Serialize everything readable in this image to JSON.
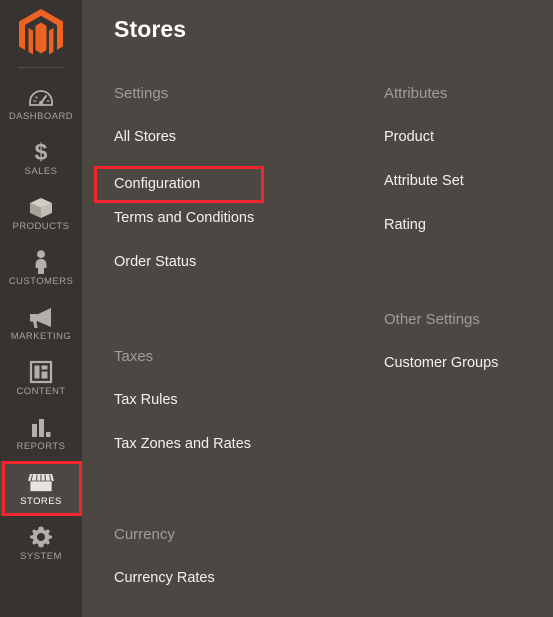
{
  "sidebar": {
    "logo": {
      "name": "magento-logo",
      "color": "#ec6323"
    },
    "items": [
      {
        "label": "Dashboard",
        "icon": "dashboard-gauge-icon",
        "active": false,
        "highlighted": false
      },
      {
        "label": "Sales",
        "icon": "dollar-sign-icon",
        "active": false,
        "highlighted": false
      },
      {
        "label": "Products",
        "icon": "box-icon",
        "active": false,
        "highlighted": false
      },
      {
        "label": "Customers",
        "icon": "person-icon",
        "active": false,
        "highlighted": false
      },
      {
        "label": "Marketing",
        "icon": "megaphone-icon",
        "active": false,
        "highlighted": false
      },
      {
        "label": "Content",
        "icon": "layout-page-icon",
        "active": false,
        "highlighted": false
      },
      {
        "label": "Reports",
        "icon": "bar-chart-icon",
        "active": false,
        "highlighted": false
      },
      {
        "label": "Stores",
        "icon": "storefront-icon",
        "active": true,
        "highlighted": true
      },
      {
        "label": "System",
        "icon": "gear-icon",
        "active": false,
        "highlighted": false
      }
    ]
  },
  "main": {
    "title": "Stores",
    "left_column": [
      {
        "heading": "Settings",
        "links": [
          {
            "label": "All Stores",
            "highlighted": false
          },
          {
            "label": "Configuration",
            "highlighted": true
          },
          {
            "label": "Terms and Conditions",
            "highlighted": false
          },
          {
            "label": "Order Status",
            "highlighted": false
          }
        ]
      },
      {
        "heading": "Taxes",
        "links": [
          {
            "label": "Tax Rules",
            "highlighted": false
          },
          {
            "label": "Tax Zones and Rates",
            "highlighted": false
          }
        ]
      },
      {
        "heading": "Currency",
        "links": [
          {
            "label": "Currency Rates",
            "highlighted": false
          }
        ]
      }
    ],
    "right_column": [
      {
        "heading": "Attributes",
        "links": [
          {
            "label": "Product",
            "highlighted": false
          },
          {
            "label": "Attribute Set",
            "highlighted": false
          },
          {
            "label": "Rating",
            "highlighted": false
          }
        ]
      },
      {
        "heading": "Other Settings",
        "links": [
          {
            "label": "Customer Groups",
            "highlighted": false
          }
        ]
      }
    ]
  },
  "annotation": {
    "color": "#f2262c"
  }
}
